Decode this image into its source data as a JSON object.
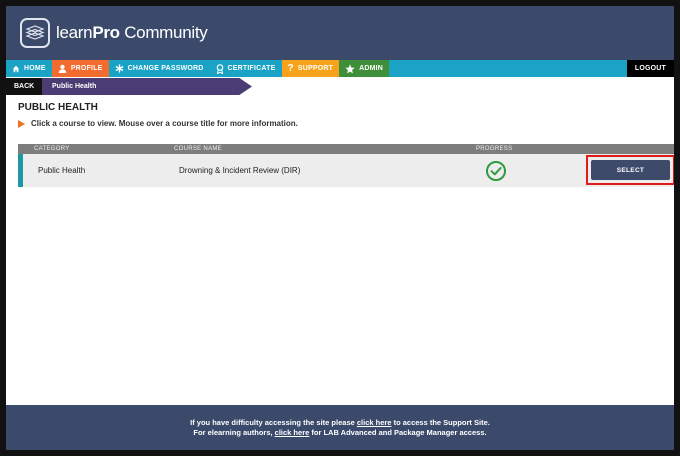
{
  "header": {
    "logo_learn": "learn",
    "logo_pro": "Pro",
    "logo_community": " Community"
  },
  "nav": {
    "home": "HOME",
    "profile": "PROFILE",
    "change_password": "CHANGE PASSWORD",
    "certificate": "CERTIFICATE",
    "support": "SUPPORT",
    "admin": "ADMIN",
    "logout": "LOGOUT"
  },
  "breadcrumb": {
    "back": "BACK",
    "current": "Public Health"
  },
  "page": {
    "title": "PUBLIC HEALTH",
    "instructions": "Click a course to view. Mouse over a course title for more information."
  },
  "table": {
    "headers": {
      "category": "CATEGORY",
      "course_name": "COURSE NAME",
      "progress": "PROGRESS"
    },
    "rows": [
      {
        "category": "Public Health",
        "course_name": "Drowning & Incident Review (DIR)",
        "progress": "complete",
        "action": "SELECT"
      }
    ]
  },
  "footer": {
    "line1_pre": "If you have difficulty accessing the site please ",
    "line1_link": "click here",
    "line1_post": " to access the Support Site.",
    "line2_pre": "For elearning authors, ",
    "line2_link": "click here",
    "line2_post": " for LAB Advanced and Package Manager access."
  },
  "colors": {
    "header_bg": "#3b4a6b",
    "nav_bg": "#1ba3c6",
    "profile_bg": "#f26b2f",
    "support_bg": "#f7a21b",
    "admin_bg": "#3f8f3a",
    "check_green": "#2e9b3e",
    "highlight_red": "#e01b1b"
  }
}
